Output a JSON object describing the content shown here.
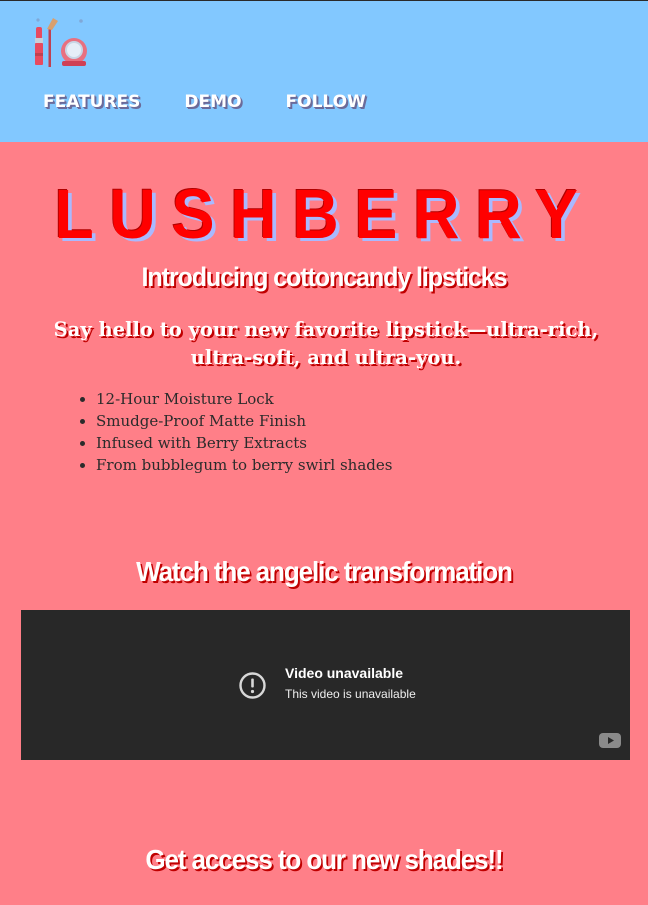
{
  "header": {
    "logo_icon": "makeup-cosmetics-icon",
    "nav": [
      {
        "label": "FEATURES"
      },
      {
        "label": "DEMO"
      },
      {
        "label": "FOLLOW"
      }
    ]
  },
  "hero": {
    "brand": "LUSHBERRY",
    "subtitle": "Introducing cottoncandy lipsticks",
    "tagline": "Say hello to your new favorite lipstick—ultra-rich, ultra-soft, and ultra-you.",
    "features": [
      "12-Hour Moisture Lock",
      "Smudge-Proof Matte Finish",
      "Infused with Berry Extracts",
      "From bubblegum to berry swirl shades"
    ]
  },
  "demo": {
    "heading": "Watch the angelic transformation",
    "video": {
      "title": "Video unavailable",
      "message": "This video is unavailable",
      "alert_icon": "alert-circle-icon",
      "brand_icon": "youtube-icon"
    }
  },
  "access": {
    "heading": "Get access to our new shades!!"
  },
  "colors": {
    "header_bg": "#82c8ff",
    "page_bg": "#ff7f88",
    "brand_red": "#ff0000",
    "video_bg": "#282828"
  }
}
